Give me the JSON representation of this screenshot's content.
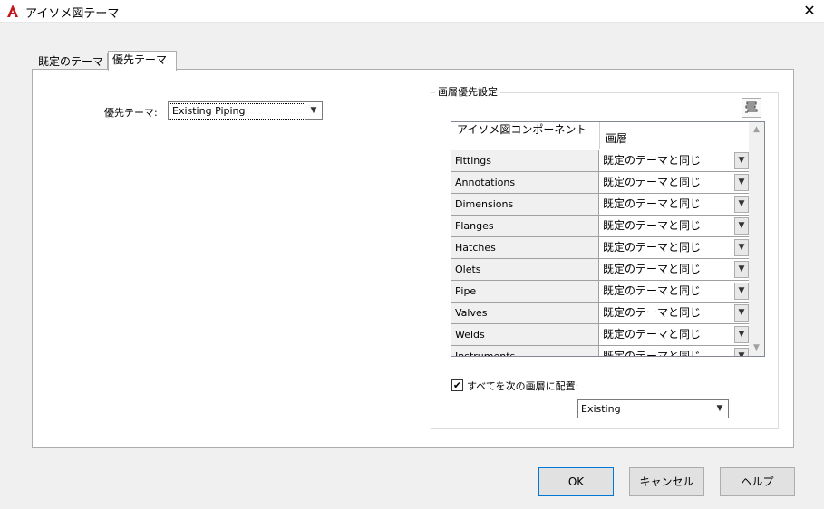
{
  "window": {
    "title": "アイソメ図テーマ",
    "close_label": "✕"
  },
  "tabs": [
    {
      "label": "既定のテーマ",
      "active": false
    },
    {
      "label": "優先テーマ",
      "active": true
    }
  ],
  "theme": {
    "label": "優先テーマ:",
    "value": "Existing Piping"
  },
  "override_group": {
    "title": "画層優先設定",
    "table": {
      "col1_header": "アイソメ図コンポーネント",
      "col2_header": "画層",
      "rows": [
        {
          "component": "Fittings",
          "layer": "既定のテーマと同じ"
        },
        {
          "component": "Annotations",
          "layer": "既定のテーマと同じ"
        },
        {
          "component": "Dimensions",
          "layer": "既定のテーマと同じ"
        },
        {
          "component": "Flanges",
          "layer": "既定のテーマと同じ"
        },
        {
          "component": "Hatches",
          "layer": "既定のテーマと同じ"
        },
        {
          "component": "Olets",
          "layer": "既定のテーマと同じ"
        },
        {
          "component": "Pipe",
          "layer": "既定のテーマと同じ"
        },
        {
          "component": "Valves",
          "layer": "既定のテーマと同じ"
        },
        {
          "component": "Welds",
          "layer": "既定のテーマと同じ"
        },
        {
          "component": "Instruments",
          "layer": "既定のテーマと同じ"
        }
      ]
    },
    "place_all": {
      "checked": true,
      "label": "すべてを次の画層に配置:",
      "value": "Existing"
    }
  },
  "buttons": {
    "ok": "OK",
    "cancel": "キャンセル",
    "help": "ヘルプ"
  },
  "colors": {
    "accent": "#0078d7",
    "app_icon": "#c4161c"
  }
}
